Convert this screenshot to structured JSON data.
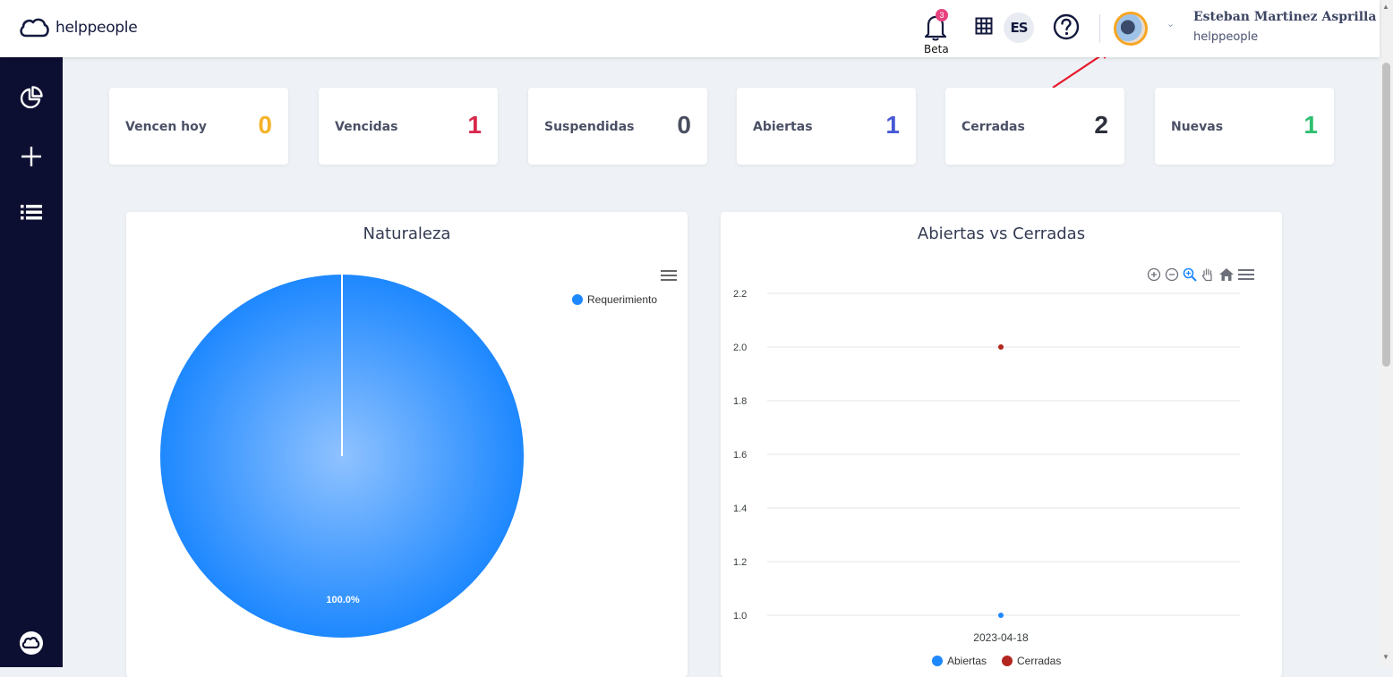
{
  "brand": {
    "name": "helppeople"
  },
  "header": {
    "notifications_badge": "3",
    "notifications_label": "Beta",
    "language": "ES",
    "user_name": "Esteban Martinez Asprilla",
    "user_org": "helppeople"
  },
  "stats": [
    {
      "label": "Vencen hoy",
      "value": "0",
      "color": "#f5b32a"
    },
    {
      "label": "Vencidas",
      "value": "1",
      "color": "#d8284c"
    },
    {
      "label": "Suspendidas",
      "value": "0",
      "color": "#4a4f60"
    },
    {
      "label": "Abiertas",
      "value": "1",
      "color": "#4758d6"
    },
    {
      "label": "Cerradas",
      "value": "2",
      "color": "#2b2f3a"
    },
    {
      "label": "Nuevas",
      "value": "1",
      "color": "#2fbf71"
    }
  ],
  "charts": {
    "pie": {
      "title": "Naturaleza",
      "legend": "Requerimiento",
      "slice_label": "100.0%",
      "color": "#1e88ff"
    },
    "line": {
      "title": "Abiertas vs Cerradas",
      "x_label": "2023-04-18",
      "y_ticks": [
        "2.2",
        "2.0",
        "1.8",
        "1.6",
        "1.4",
        "1.2",
        "1.0"
      ],
      "series": [
        {
          "name": "Abiertas",
          "color": "#1e88ff"
        },
        {
          "name": "Cerradas",
          "color": "#b3261e"
        }
      ]
    }
  },
  "chart_data": [
    {
      "type": "pie",
      "title": "Naturaleza",
      "categories": [
        "Requerimiento"
      ],
      "values": [
        100.0
      ]
    },
    {
      "type": "scatter",
      "title": "Abiertas vs Cerradas",
      "x": [
        "2023-04-18"
      ],
      "series": [
        {
          "name": "Abiertas",
          "values": [
            1
          ]
        },
        {
          "name": "Cerradas",
          "values": [
            2
          ]
        }
      ],
      "ylim": [
        1.0,
        2.2
      ],
      "grid": true,
      "legend": "bottom"
    }
  ]
}
